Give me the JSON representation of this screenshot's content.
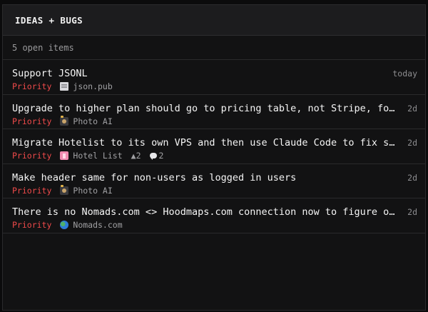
{
  "panel": {
    "title": "IDEAS + BUGS",
    "summary": "5 open items"
  },
  "colors": {
    "priority": "#ef4a4a",
    "background": "#121213",
    "header": "#1c1c1e"
  },
  "items": [
    {
      "title": "Support JSONL",
      "time": "today",
      "priority": "Priority",
      "project": "json.pub",
      "project_icon": "document-icon"
    },
    {
      "title": "Upgrade to higher plan should go to pricing table, not Stripe, for eas…",
      "time": "2d",
      "priority": "Priority",
      "project": "Photo AI",
      "project_icon": "camera-icon"
    },
    {
      "title": "Migrate Hotelist to its own VPS and then use Claude Code to fix slow DB",
      "time": "2d",
      "priority": "Priority",
      "project": "Hotel List",
      "project_icon": "hotel-icon",
      "upvotes": "▲2",
      "comments": "2"
    },
    {
      "title": "Make header same for non-users as logged in users",
      "time": "2d",
      "priority": "Priority",
      "project": "Photo AI",
      "project_icon": "camera-icon"
    },
    {
      "title": "There is no Nomads.com <> Hoodmaps.com connection now to figure out be…",
      "time": "2d",
      "priority": "Priority",
      "project": "Nomads.com",
      "project_icon": "globe-icon"
    }
  ]
}
